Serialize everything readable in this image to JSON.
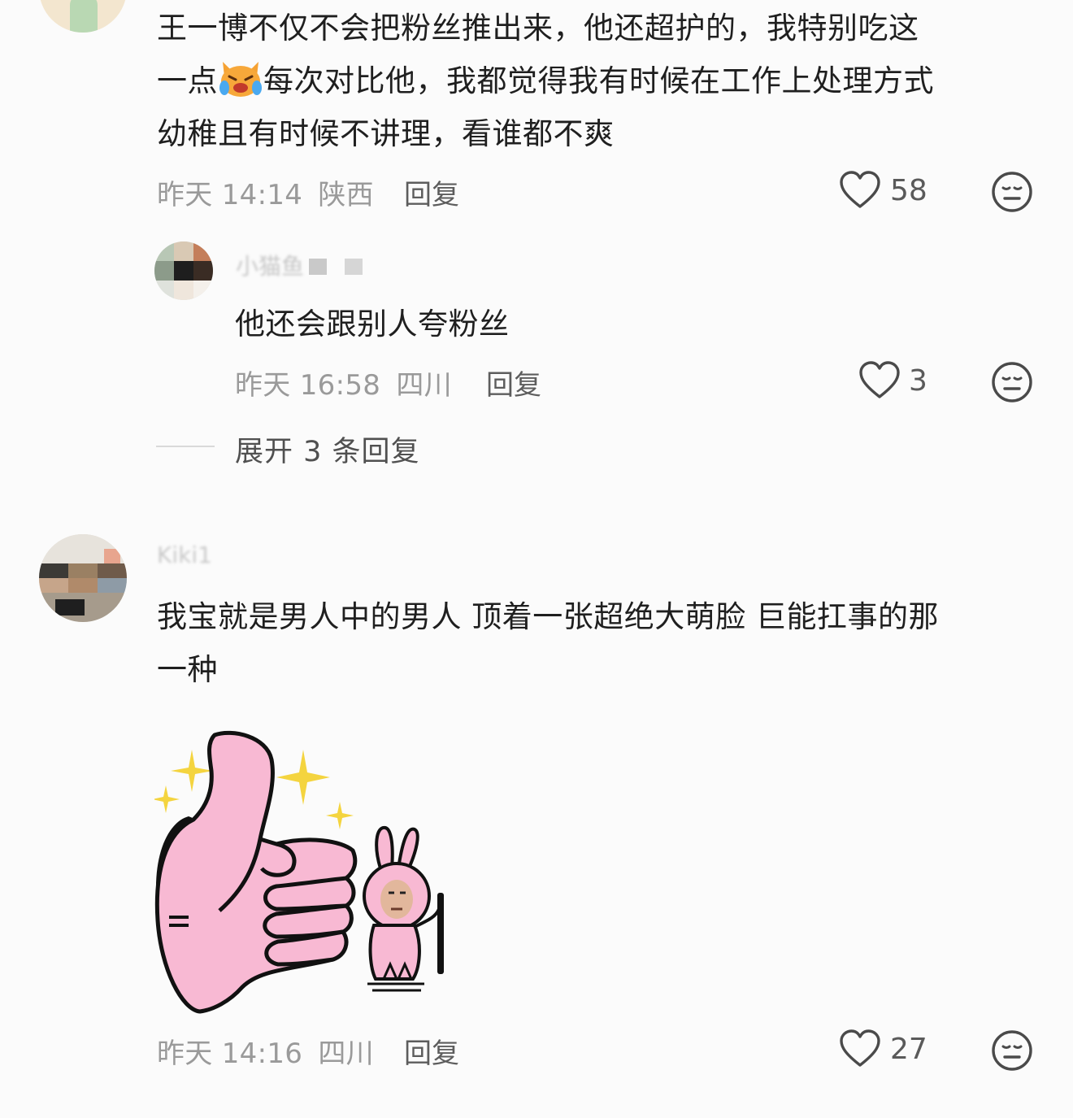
{
  "comments": [
    {
      "text_lines": [
        "王一博不仅不会把粉丝推出来，他还超护的，我特别吃这",
        "一点",
        "每次对比他，我都觉得我有时候在工作上处理方式",
        "幼稚且有时候不讲理，看谁都不爽"
      ],
      "emoji_icon": "crying-cat-emoji-icon",
      "time": "昨天 14:14",
      "location": "陕西",
      "reply_label": "回复",
      "like_count": "58"
    },
    {
      "username": "小猫鱼",
      "text": "他还会跟别人夸粉丝",
      "time": "昨天 16:58",
      "location": "四川",
      "reply_label": "回复",
      "like_count": "3",
      "expand_label": "展开 3 条回复"
    },
    {
      "username": "Kiki1",
      "text_lines": [
        "我宝就是男人中的男人 顶着一张超绝大萌脸 巨能扛事的那",
        "一种"
      ],
      "sticker_icon": "thumbs-up-bunny-sticker",
      "time": "昨天 14:16",
      "location": "四川",
      "reply_label": "回复",
      "like_count": "27"
    }
  ],
  "colors": {
    "background": "#fbfbfb",
    "text": "#1f1f1f",
    "meta": "#9a9a9a",
    "sticker_pink": "#f8b9d3"
  }
}
